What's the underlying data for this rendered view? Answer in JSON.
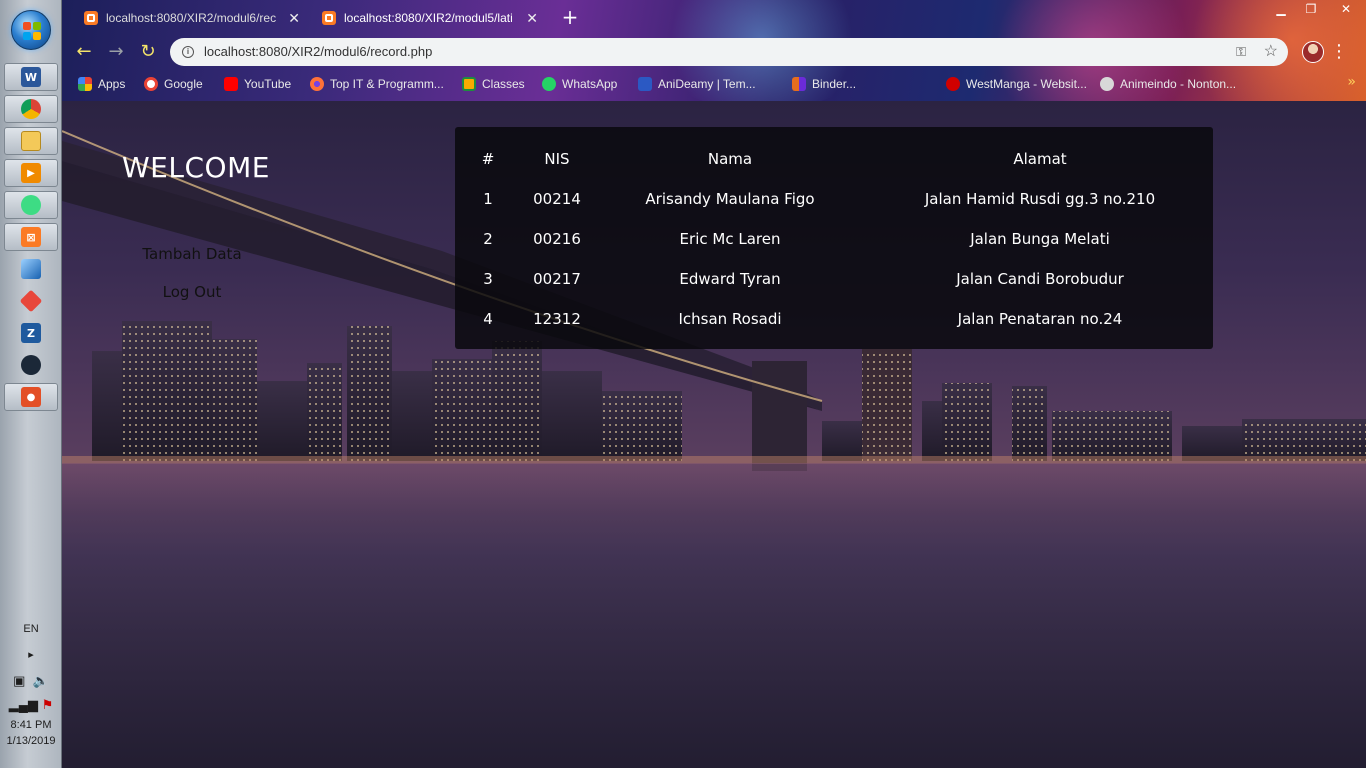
{
  "taskbar": {
    "pinned": [
      "word-icon",
      "chrome-icon",
      "file-explorer-icon",
      "media-player-icon",
      "android-studio-icon",
      "xampp-icon",
      "virtualbox-icon",
      "git-icon",
      "filezilla-icon",
      "steam-icon",
      "bandicam-icon"
    ],
    "language": "EN",
    "time": "8:41 PM",
    "date": "1/13/2019"
  },
  "browser": {
    "tabs": [
      {
        "title": "localhost:8080/XIR2/modul6/rec",
        "active": false
      },
      {
        "title": "localhost:8080/XIR2/modul5/lati",
        "active": true
      }
    ],
    "url": "localhost:8080/XIR2/modul6/record.php",
    "bookmarks": [
      {
        "label": "Apps",
        "icon": "apps-icon",
        "color": "#4285f4"
      },
      {
        "label": "Google",
        "icon": "google-icon",
        "color": "#ea4335"
      },
      {
        "label": "YouTube",
        "icon": "youtube-icon",
        "color": "#ff0000"
      },
      {
        "label": "Top IT & Programm...",
        "icon": "firefox-icon",
        "color": "#ff7139"
      },
      {
        "label": "Classes",
        "icon": "classroom-icon",
        "color": "#f9ab00"
      },
      {
        "label": "WhatsApp",
        "icon": "whatsapp-icon",
        "color": "#25d366"
      },
      {
        "label": "AniDeamy | Tem...",
        "icon": "anime-icon",
        "color": "#2b59c3"
      },
      {
        "label": "Binder...",
        "icon": "binder-icon",
        "color": "#e66d1d"
      },
      {
        "label": "WestManga - Websit...",
        "icon": "westmanga-icon",
        "color": "#d00000"
      },
      {
        "label": "Animeindo - Nonton...",
        "icon": "animeindo-icon",
        "color": "#c9c9c9"
      }
    ]
  },
  "sidebar": {
    "welcome": "WELCOME",
    "links": [
      "Tambah Data",
      "Log Out"
    ]
  },
  "table": {
    "headers": [
      "#",
      "NIS",
      "Nama",
      "Alamat"
    ],
    "rows": [
      [
        "1",
        "00214",
        "Arisandy Maulana Figo",
        "Jalan Hamid Rusdi gg.3 no.210"
      ],
      [
        "2",
        "00216",
        "Eric Mc Laren",
        "Jalan Bunga Melati"
      ],
      [
        "3",
        "00217",
        "Edward Tyran",
        "Jalan Candi Borobudur"
      ],
      [
        "4",
        "12312",
        "Ichsan Rosadi",
        "Jalan Penataran no.24"
      ]
    ]
  }
}
